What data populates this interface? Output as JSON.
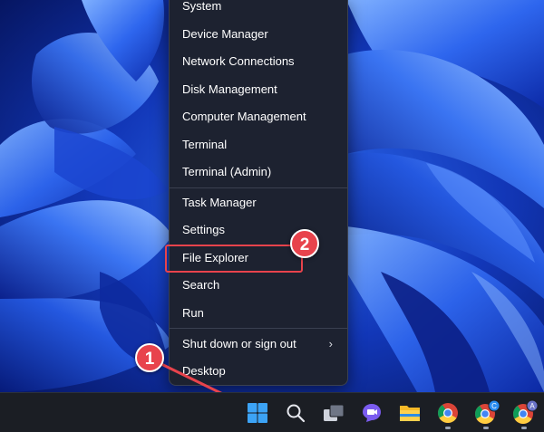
{
  "menu": {
    "items": [
      {
        "label": "System"
      },
      {
        "label": "Device Manager"
      },
      {
        "label": "Network Connections"
      },
      {
        "label": "Disk Management"
      },
      {
        "label": "Computer Management"
      },
      {
        "label": "Terminal"
      },
      {
        "label": "Terminal (Admin)"
      },
      {
        "label": "Task Manager"
      },
      {
        "label": "Settings"
      },
      {
        "label": "File Explorer"
      },
      {
        "label": "Search"
      },
      {
        "label": "Run"
      },
      {
        "label": "Shut down or sign out",
        "has_submenu": true
      },
      {
        "label": "Desktop"
      }
    ],
    "submenu_chevron": "›"
  },
  "annotations": {
    "step1": "1",
    "step2": "2",
    "highlight_color": "#e8434c"
  },
  "taskbar": {
    "icons": [
      {
        "name": "windows-start-icon"
      },
      {
        "name": "search-icon"
      },
      {
        "name": "task-view-icon"
      },
      {
        "name": "chat-icon"
      },
      {
        "name": "file-explorer-icon"
      },
      {
        "name": "chrome-icon"
      },
      {
        "name": "chrome-profile-icon",
        "badge": "C"
      },
      {
        "name": "chrome-profile-icon",
        "badge": "A"
      }
    ]
  },
  "colors": {
    "menu_bg": "#1d2230",
    "taskbar_bg": "#1b1e24",
    "accent": "#e8434c"
  }
}
